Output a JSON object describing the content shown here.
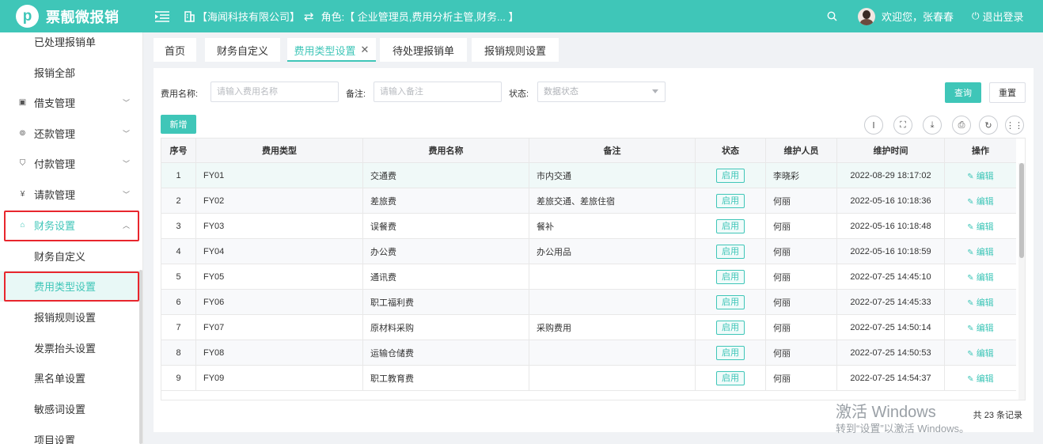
{
  "header": {
    "logo_letter": "p",
    "app_name": "票靓微报销",
    "company": "【海闻科技有限公司】",
    "role": "角色:【 企业管理员,费用分析主管,财务... 】",
    "welcome": "欢迎您，张春春",
    "logout": "退出登录"
  },
  "sidebar": {
    "items": [
      {
        "label": "已处理报销单"
      },
      {
        "label": "报销全部"
      },
      {
        "label": "借支管理"
      },
      {
        "label": "还款管理"
      },
      {
        "label": "付款管理"
      },
      {
        "label": "请款管理"
      },
      {
        "label": "财务设置"
      },
      {
        "label": "财务自定义"
      },
      {
        "label": "费用类型设置"
      },
      {
        "label": "报销规则设置"
      },
      {
        "label": "发票抬头设置"
      },
      {
        "label": "黑名单设置"
      },
      {
        "label": "敏感词设置"
      },
      {
        "label": "项目设置"
      }
    ]
  },
  "tabs": [
    {
      "label": "首页"
    },
    {
      "label": "财务自定义"
    },
    {
      "label": "费用类型设置"
    },
    {
      "label": "待处理报销单"
    },
    {
      "label": "报销规则设置"
    }
  ],
  "filters": {
    "name_label": "费用名称:",
    "name_placeholder": "请输入费用名称",
    "remark_label": "备注:",
    "remark_placeholder": "请输入备注",
    "status_label": "状态:",
    "status_placeholder": "数据状态",
    "query_button": "查询",
    "reset_button": "重置",
    "add_button": "新增"
  },
  "table": {
    "columns": [
      "序号",
      "费用类型",
      "费用名称",
      "备注",
      "状态",
      "维护人员",
      "维护时间",
      "操作"
    ],
    "rows": [
      {
        "no": "1",
        "type": "FY01",
        "name": "交通费",
        "remark": "市内交通",
        "status": "启用",
        "maintainer": "李晓彩",
        "time": "2022-08-29 18:17:02",
        "action": "编辑"
      },
      {
        "no": "2",
        "type": "FY02",
        "name": "差旅费",
        "remark": "差旅交通、差旅住宿",
        "status": "启用",
        "maintainer": "何丽",
        "time": "2022-05-16 10:18:36",
        "action": "编辑"
      },
      {
        "no": "3",
        "type": "FY03",
        "name": "误餐费",
        "remark": "餐补",
        "status": "启用",
        "maintainer": "何丽",
        "time": "2022-05-16 10:18:48",
        "action": "编辑"
      },
      {
        "no": "4",
        "type": "FY04",
        "name": "办公费",
        "remark": "办公用品",
        "status": "启用",
        "maintainer": "何丽",
        "time": "2022-05-16 10:18:59",
        "action": "编辑"
      },
      {
        "no": "5",
        "type": "FY05",
        "name": "通讯费",
        "remark": "",
        "status": "启用",
        "maintainer": "何丽",
        "time": "2022-07-25 14:45:10",
        "action": "编辑"
      },
      {
        "no": "6",
        "type": "FY06",
        "name": "职工福利费",
        "remark": "",
        "status": "启用",
        "maintainer": "何丽",
        "time": "2022-07-25 14:45:33",
        "action": "编辑"
      },
      {
        "no": "7",
        "type": "FY07",
        "name": "原材料采购",
        "remark": "采购费用",
        "status": "启用",
        "maintainer": "何丽",
        "time": "2022-07-25 14:50:14",
        "action": "编辑"
      },
      {
        "no": "8",
        "type": "FY08",
        "name": "运输仓储费",
        "remark": "",
        "status": "启用",
        "maintainer": "何丽",
        "time": "2022-07-25 14:50:53",
        "action": "编辑"
      },
      {
        "no": "9",
        "type": "FY09",
        "name": "职工教育费",
        "remark": "",
        "status": "启用",
        "maintainer": "何丽",
        "time": "2022-07-25 14:54:37",
        "action": "编辑"
      }
    ],
    "total": "共 23 条记录"
  },
  "watermark": {
    "line1": "激活 Windows",
    "line2": "转到“设置”以激活 Windows。"
  },
  "colors": {
    "accent": "#3fc6b8",
    "highlight_box": "#e8262d"
  }
}
